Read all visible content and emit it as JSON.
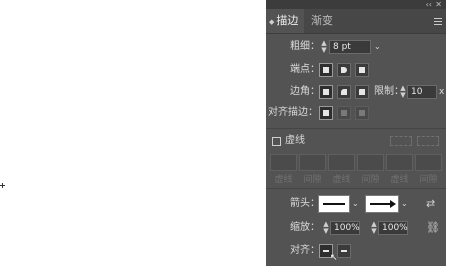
{
  "panel": {
    "tabs": [
      {
        "label": "描边"
      },
      {
        "label": "渐变"
      }
    ],
    "controls": {
      "collapse": "‹‹",
      "close": "✕"
    },
    "weight": {
      "label": "粗细：",
      "value": "8 pt"
    },
    "cap": {
      "label": "端点："
    },
    "corner": {
      "label": "边角：",
      "limit_label": "限制：",
      "limit_value": "10",
      "limit_unit": "x"
    },
    "align": {
      "label": "对齐描边："
    },
    "dashed": {
      "label": "虚线"
    },
    "dash_fields": [
      "虚线",
      "间隙",
      "虚线",
      "间隙",
      "虚线",
      "间隙"
    ],
    "arrowheads": {
      "label": "箭头："
    },
    "scale": {
      "label": "缩放：",
      "start": "100%",
      "end": "100%"
    },
    "arrow_align": {
      "label": "对齐："
    }
  }
}
